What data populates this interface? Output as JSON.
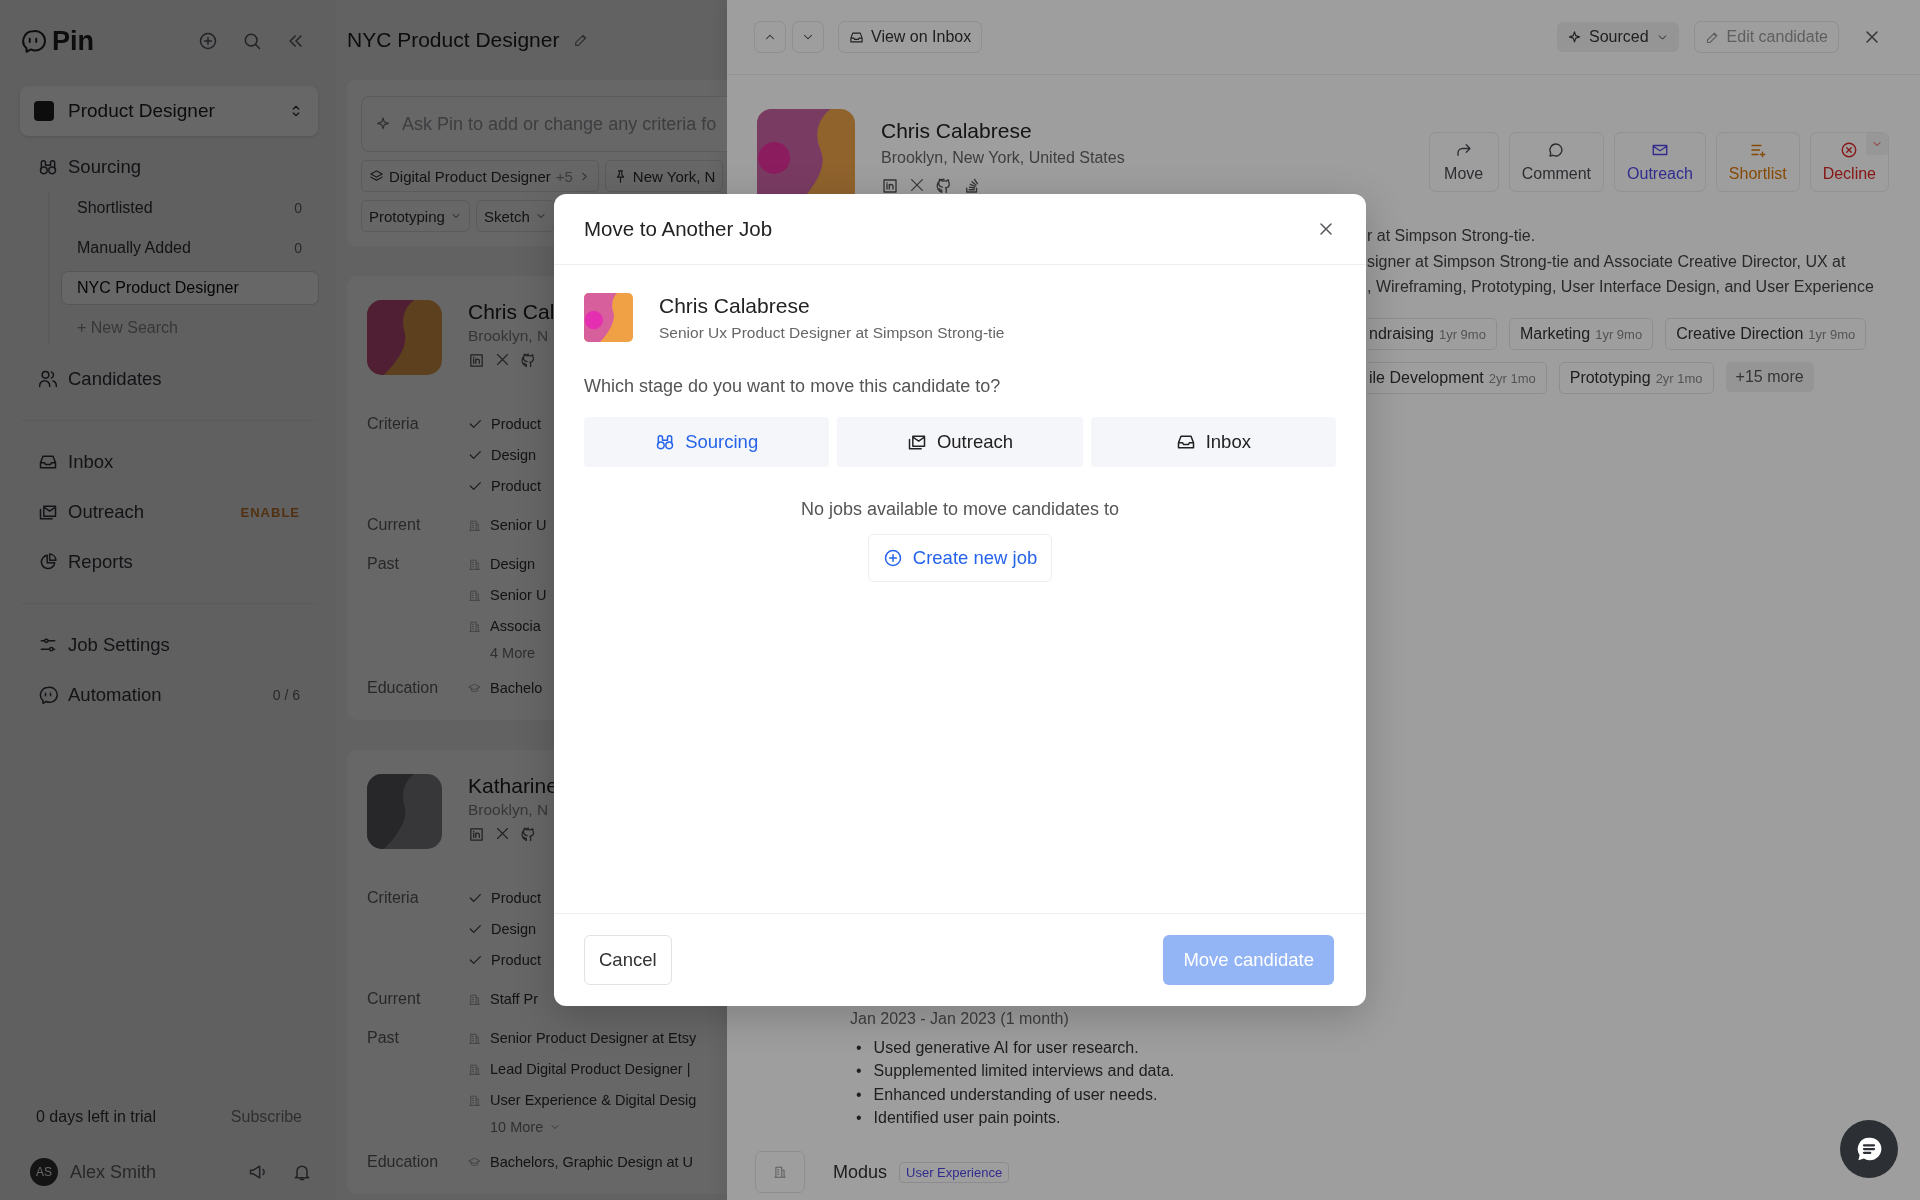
{
  "sidebar": {
    "brand": "Pin",
    "job_selector": "Product Designer",
    "nav_groups": [
      [
        {
          "label": "Sourcing",
          "expanded": true,
          "children": [
            {
              "label": "Shortlisted",
              "count": "0",
              "selected": false,
              "kind": "list"
            },
            {
              "label": "Manually Added",
              "count": "0",
              "selected": false,
              "kind": "list"
            },
            {
              "label": "NYC Product Designer",
              "selected": true,
              "kind": "list"
            },
            {
              "label": "+ New Search",
              "selected": false,
              "kind": "action"
            }
          ]
        },
        {
          "label": "Candidates"
        }
      ],
      [
        {
          "label": "Inbox"
        },
        {
          "label": "Outreach",
          "badge": "ENABLE"
        },
        {
          "label": "Reports"
        }
      ],
      [
        {
          "label": "Job Settings"
        },
        {
          "label": "Automation",
          "count": "0 / 6"
        }
      ]
    ],
    "trial": {
      "text": "0 days left in trial",
      "action": "Subscribe"
    },
    "user": {
      "initials": "AS",
      "name": "Alex Smith"
    }
  },
  "search_list": {
    "title": "NYC Product Designer",
    "search": {
      "placeholder": "Ask Pin to add or change any criteria fo"
    },
    "filters": [
      [
        {
          "label": "Digital Product Designer",
          "extra": "+5",
          "kind": "title"
        },
        {
          "label": "New York, N",
          "kind": "location"
        }
      ],
      [
        {
          "label": "Prototyping",
          "kind": "skill"
        },
        {
          "label": "Sketch",
          "kind": "skill"
        }
      ]
    ],
    "candidates": [
      {
        "name": "Chris Cal",
        "location": "Brooklyn, N",
        "sections": [
          {
            "label": "Criteria",
            "kind": "criteria",
            "items": [
              "Product",
              "Design",
              "Product"
            ]
          },
          {
            "label": "Current",
            "kind": "job",
            "items": [
              "Senior U"
            ]
          },
          {
            "label": "Past",
            "kind": "job",
            "items": [
              "Design",
              "Senior U",
              "Associa"
            ],
            "more": "4 More"
          },
          {
            "label": "Education",
            "kind": "school",
            "items": [
              "Bachelo"
            ]
          }
        ]
      },
      {
        "name": "Katharine",
        "location": "Brooklyn, N",
        "sections": [
          {
            "label": "Criteria",
            "kind": "criteria",
            "items": [
              "Product",
              "Design",
              "Product"
            ]
          },
          {
            "label": "Current",
            "kind": "job",
            "items": [
              "Staff Pr"
            ]
          },
          {
            "label": "Past",
            "kind": "job",
            "items": [
              "Senior Product Designer at Etsy",
              "Lead Digital Product Designer |",
              "User Experience & Digital Desig"
            ],
            "more": "10 More"
          },
          {
            "label": "Education",
            "kind": "school",
            "items": [
              "Bachelors, Graphic Design at U"
            ]
          }
        ]
      }
    ]
  },
  "detail": {
    "view_inbox": "View on Inbox",
    "status": "Sourced",
    "edit": "Edit candidate",
    "name": "Chris Calabrese",
    "location": "Brooklyn, New York, United States",
    "actions": [
      {
        "label": "Move",
        "kind": "plain"
      },
      {
        "label": "Comment",
        "kind": "plain"
      },
      {
        "label": "Outreach",
        "kind": "outreach"
      },
      {
        "label": "Shortlist",
        "kind": "shortlist"
      },
      {
        "label": "Decline",
        "kind": "decline"
      }
    ],
    "summary": [
      "r at Simpson Strong-tie.",
      "signer at Simpson Strong-tie and Associate Creative Director, UX at",
      ", Wireframing, Prototyping, User Interface Design, and User Experience"
    ],
    "skills": [
      [
        {
          "name": "ndraising",
          "duration": "1yr 9mo"
        },
        {
          "name": "Marketing",
          "duration": "1yr 9mo"
        },
        {
          "name": "Creative Direction",
          "duration": "1yr 9mo"
        }
      ],
      [
        {
          "name": "ile Development",
          "duration": "2yr 1mo"
        },
        {
          "name": "Prototyping",
          "duration": "2yr 1mo"
        }
      ]
    ],
    "more_skills": "+15 more",
    "experience": {
      "dates": "Jan 2023 - Jan 2023 (1 month)",
      "bullets": [
        {
          "marker": "•",
          "text": "Used generative AI for user research."
        },
        {
          "marker": "•",
          "text": "Supplemented limited interviews and data."
        },
        {
          "marker": "•",
          "text": "Enhanced understanding of user needs."
        },
        {
          "marker": "•",
          "text": "Identified user pain points."
        }
      ]
    },
    "company": {
      "name": "Modus",
      "tag": "User Experience"
    }
  },
  "modal": {
    "title": "Move to Another Job",
    "candidate": {
      "name": "Chris Calabrese",
      "headline": "Senior Ux Product Designer at Simpson Strong-tie"
    },
    "question": "Which stage do you want to move this candidate to?",
    "stages": [
      {
        "label": "Sourcing",
        "selected": true
      },
      {
        "label": "Outreach",
        "selected": false
      },
      {
        "label": "Inbox",
        "selected": false
      }
    ],
    "empty": "No jobs available to move candidates to",
    "create": "Create new job",
    "cancel": "Cancel",
    "confirm": {
      "label": "Move candidate",
      "disabled": true
    }
  }
}
